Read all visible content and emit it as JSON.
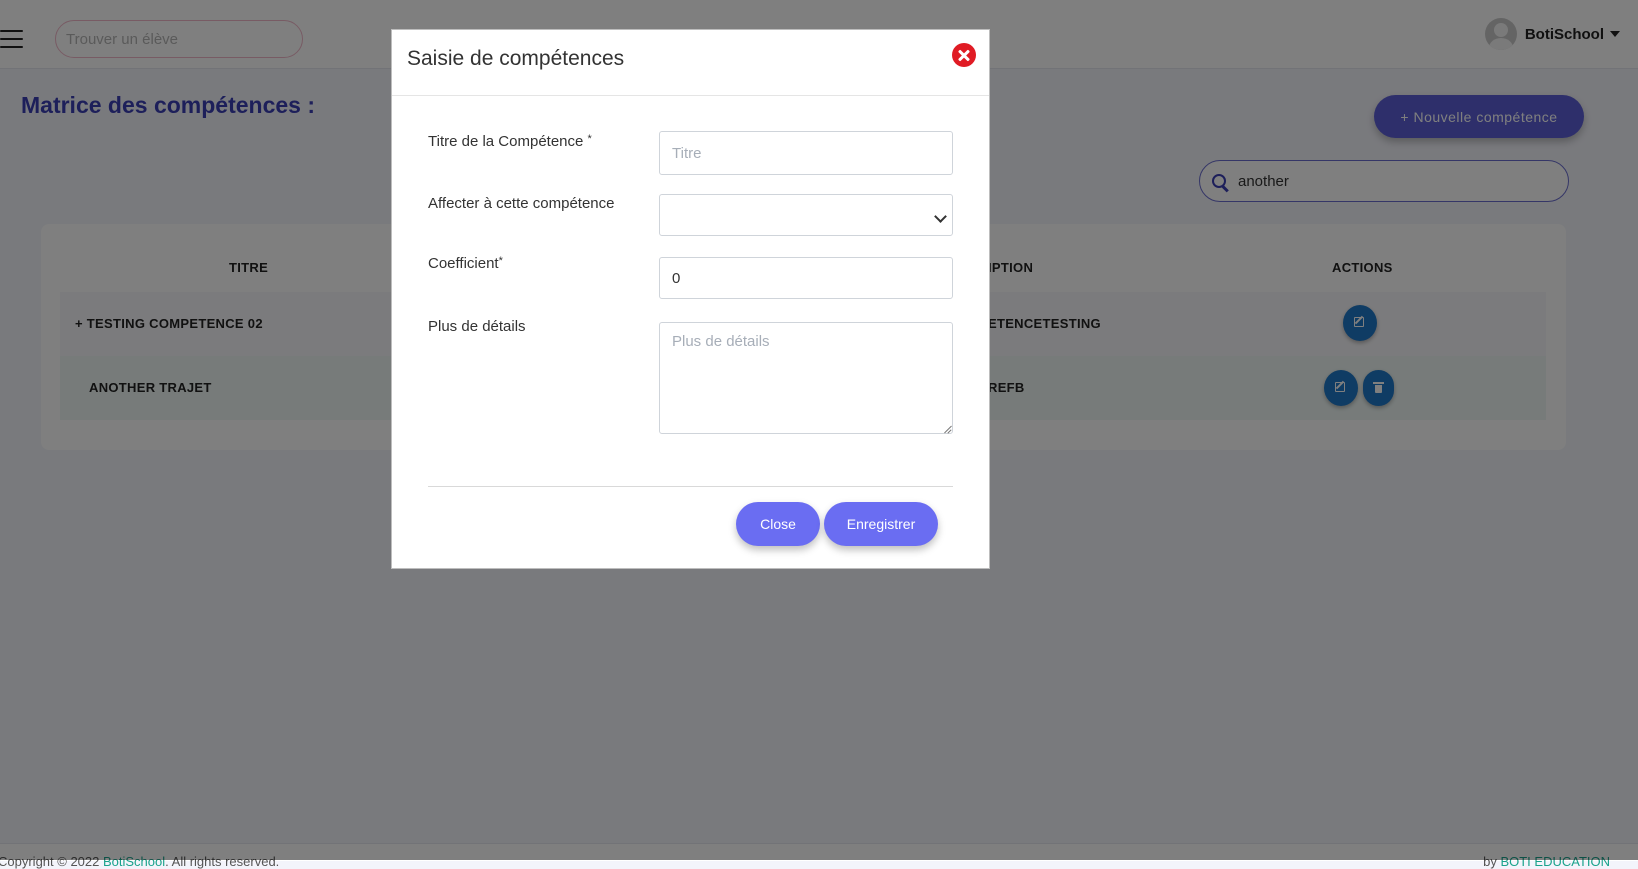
{
  "topbar": {
    "search_placeholder": "Trouver un élève",
    "user_name": "BotiSchool"
  },
  "page": {
    "title": "Matrice des compétences :",
    "new_button_label": "+ Nouvelle compétence",
    "table_search_value": "another"
  },
  "table": {
    "headers": [
      "TITRE",
      "IPTION",
      "ACTIONS"
    ],
    "rows": [
      {
        "title": "+ TESTING COMPETENCE 02",
        "description": "ETENCETESTING",
        "actions": [
          "edit"
        ]
      },
      {
        "title": "ANOTHER TRAJET",
        "description": "REFB",
        "actions": [
          "edit",
          "delete"
        ]
      }
    ]
  },
  "modal": {
    "title": "Saisie de compétences",
    "fields": {
      "titre_label": "Titre de la Compétence",
      "titre_placeholder": "Titre",
      "affecter_label": "Affecter à cette compétence",
      "affecter_value": "",
      "coefficient_label": "Coefficient",
      "coefficient_value": "0",
      "details_label": "Plus de détails",
      "details_placeholder": "Plus de détails"
    },
    "required_mark": "*",
    "close_label": "Close",
    "save_label": "Enregistrer"
  },
  "footer": {
    "left_prefix": "Copyright © 2022 ",
    "left_link": "BotiSchool",
    "left_suffix": ". All rights reserved.",
    "right_prefix": "by ",
    "right_link": "BOTI EDUCATION"
  },
  "colors": {
    "accent": "#5c5fd6",
    "title": "#3b3fb5",
    "action_button": "#1f78c8",
    "danger": "#e01b24"
  }
}
